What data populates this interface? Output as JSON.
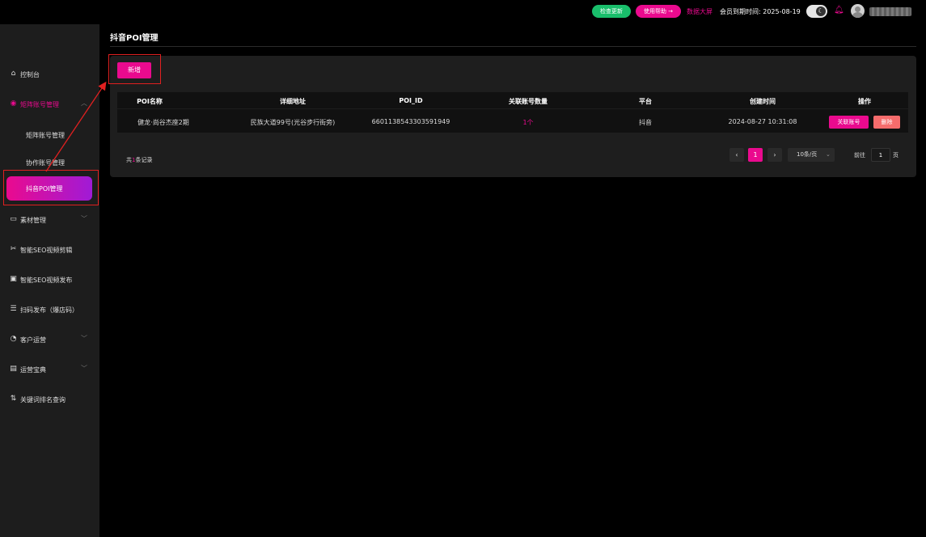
{
  "topbar": {
    "check_update": "检查更新",
    "help": "使用帮助 →",
    "data_screen": "数据大屏",
    "expire_label": "会员到期时间:",
    "expire_date": "2025-08-19",
    "theme_icon": "moon-icon",
    "bell_icon": "bell-icon"
  },
  "sidebar": {
    "items": [
      {
        "label": "控制台",
        "icon": "⌂"
      },
      {
        "label": "矩阵账号管理",
        "icon": "◉"
      },
      {
        "label": "素材管理",
        "icon": "▭"
      },
      {
        "label": "智能SEO视频剪辑",
        "icon": "✂"
      },
      {
        "label": "智能SEO视频发布",
        "icon": "▣"
      },
      {
        "label": "扫码发布（爆店码）",
        "icon": "☰"
      },
      {
        "label": "客户运营",
        "icon": "◔"
      },
      {
        "label": "运营宝典",
        "icon": "▤"
      },
      {
        "label": "关键词排名查询",
        "icon": "⇅"
      }
    ],
    "sub_items": [
      "矩阵账号管理",
      "协作账号管理",
      "抖音POI管理"
    ]
  },
  "page": {
    "title": "抖音POI管理",
    "add_button": "新增"
  },
  "table": {
    "headers": [
      "POI名称",
      "详细地址",
      "POI_ID",
      "关联账号数量",
      "平台",
      "创建时间",
      "操作"
    ],
    "rows": [
      {
        "name": "健龙·尚谷杰座2期",
        "address": "民族大道99号(光谷步行街旁)",
        "poi_id": "6601138543303591949",
        "count": "1个",
        "platform": "抖音",
        "created": "2024-08-27 10:31:08",
        "action_link": "关联账号",
        "action_delete": "删除"
      }
    ]
  },
  "pagination": {
    "total_prefix": "共",
    "total": "1",
    "total_suffix": "条记录",
    "prev": "‹",
    "current": "1",
    "next": "›",
    "page_size": "10条/页",
    "goto_label": "前往",
    "goto_value": "1",
    "page_label": "页"
  },
  "colors": {
    "accent": "#ea0a8e",
    "success": "#19be6b",
    "danger": "#f56c6c",
    "annotation": "#e02020"
  }
}
